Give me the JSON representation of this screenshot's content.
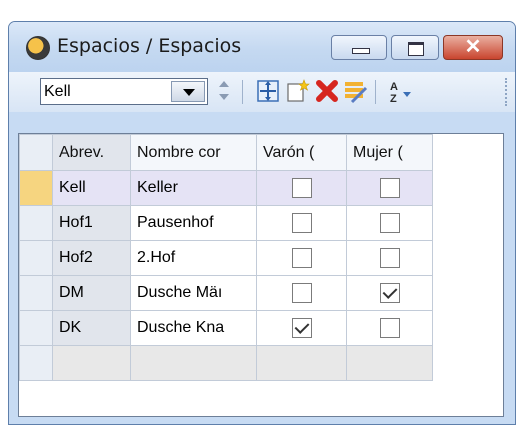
{
  "window": {
    "title": "Espacios / Espacios",
    "close_glyph": "✕"
  },
  "toolbar": {
    "selector_value": "Kell",
    "icons": [
      "move-icon",
      "new-record-icon",
      "delete-icon",
      "edit-list-icon",
      "sort-icon"
    ]
  },
  "table": {
    "headers": [
      "Abrev.",
      "Nombre cor",
      "Varón (",
      "Mujer ("
    ],
    "rows": [
      {
        "abrev": "Kell",
        "nombre": "Keller",
        "varon": false,
        "mujer": false
      },
      {
        "abrev": "Hof1",
        "nombre": "Pausenhof",
        "varon": false,
        "mujer": false
      },
      {
        "abrev": "Hof2",
        "nombre": "2.Hof",
        "varon": false,
        "mujer": false
      },
      {
        "abrev": "DM",
        "nombre": "Dusche Mäı",
        "varon": false,
        "mujer": true
      },
      {
        "abrev": "DK",
        "nombre": "Dusche Kna",
        "varon": true,
        "mujer": false
      }
    ]
  },
  "colors": {
    "selected_row": "#e5e3f5",
    "row_indicator": "#f6d580",
    "close_button": "#c9452f"
  }
}
